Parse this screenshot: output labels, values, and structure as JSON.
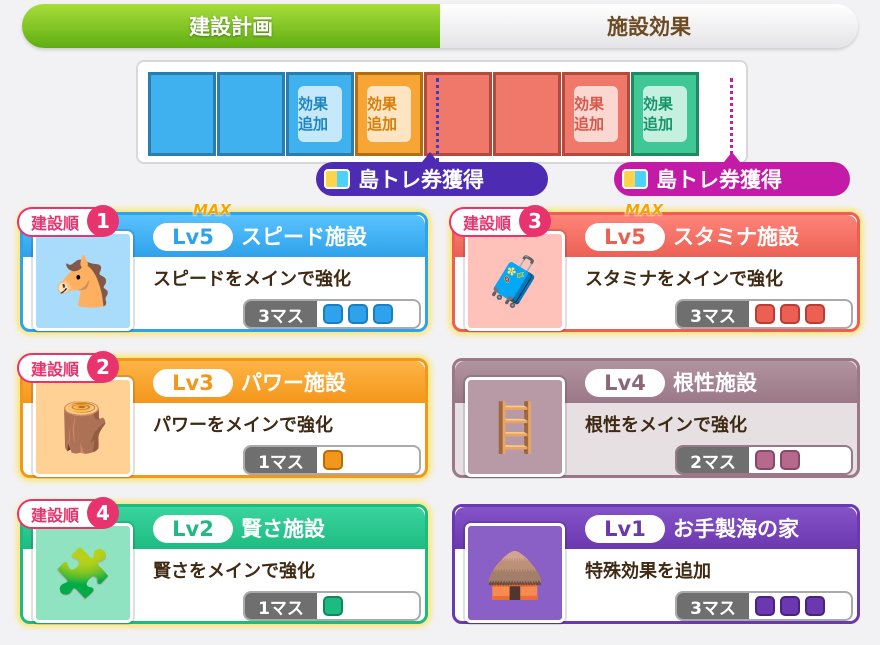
{
  "tabs": {
    "plan": "建設計画",
    "effects": "施設効果"
  },
  "progress": {
    "cells": [
      {
        "color": "blue",
        "label": ""
      },
      {
        "color": "blue",
        "label": ""
      },
      {
        "color": "blue",
        "label": "効果追加"
      },
      {
        "color": "orange",
        "label": "効果追加"
      },
      {
        "color": "red",
        "label": ""
      },
      {
        "color": "red",
        "label": ""
      },
      {
        "color": "red",
        "label": "効果追加"
      },
      {
        "color": "green",
        "label": "効果追加"
      }
    ],
    "tickets": [
      "島トレ券獲得",
      "島トレ券獲得"
    ]
  },
  "cards": [
    {
      "theme": "blue",
      "order_label": "建設順",
      "order": "1",
      "max": "MAX",
      "level": "Lv5",
      "name": "スピード施設",
      "desc": "スピードをメインで強化",
      "mass": "3マス",
      "pips": 3,
      "icon": "🐴"
    },
    {
      "theme": "red",
      "order_label": "建設順",
      "order": "3",
      "max": "MAX",
      "level": "Lv5",
      "name": "スタミナ施設",
      "desc": "スタミナをメインで強化",
      "mass": "3マス",
      "pips": 3,
      "icon": "🧳"
    },
    {
      "theme": "orange",
      "order_label": "建設順",
      "order": "2",
      "max": "",
      "level": "Lv3",
      "name": "パワー施設",
      "desc": "パワーをメインで強化",
      "mass": "1マス",
      "pips": 1,
      "icon": "🪵"
    },
    {
      "theme": "gray",
      "order_label": "",
      "order": "",
      "max": "",
      "level": "Lv4",
      "name": "根性施設",
      "desc": "根性をメインで強化",
      "mass": "2マス",
      "pips": 2,
      "icon": "🪜"
    },
    {
      "theme": "green",
      "order_label": "建設順",
      "order": "4",
      "max": "",
      "level": "Lv2",
      "name": "賢さ施設",
      "desc": "賢さをメインで強化",
      "mass": "1マス",
      "pips": 1,
      "icon": "🧩"
    },
    {
      "theme": "purple",
      "order_label": "",
      "order": "",
      "max": "",
      "level": "Lv1",
      "name": "お手製海の家",
      "desc": "特殊効果を追加",
      "mass": "3マス",
      "pips": 3,
      "icon": "🛖"
    }
  ]
}
